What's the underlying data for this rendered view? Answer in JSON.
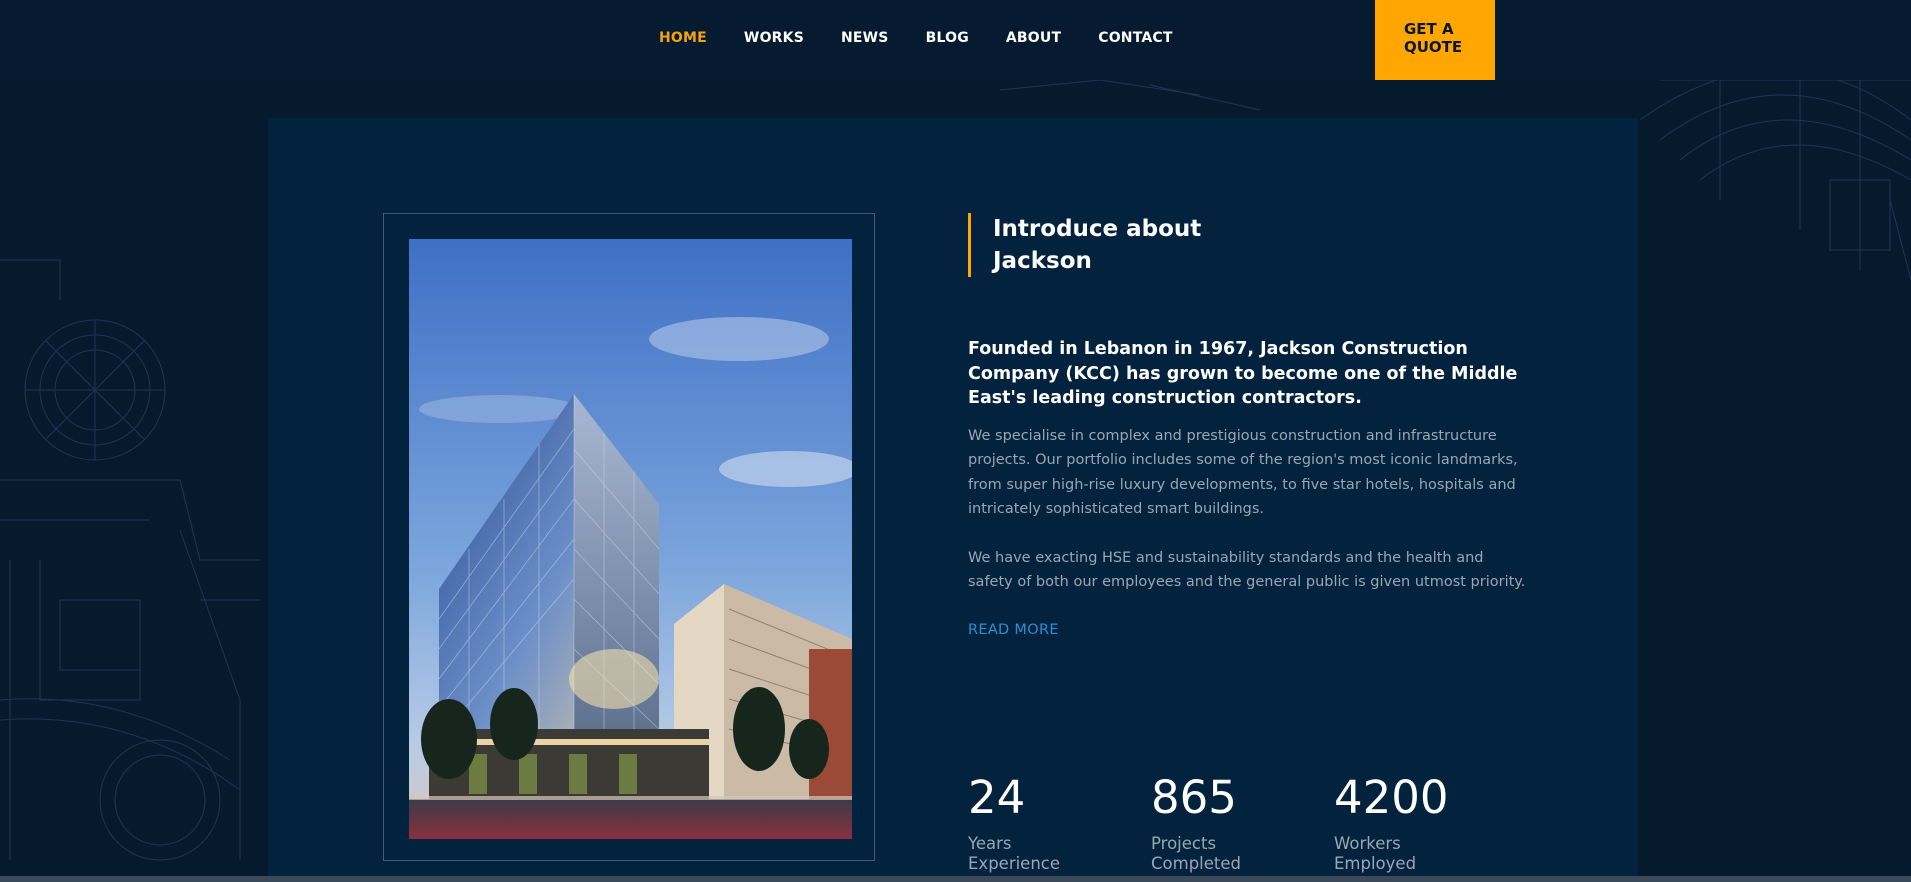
{
  "nav": {
    "items": [
      "HOME",
      "WORKS",
      "NEWS",
      "BLOG",
      "ABOUT",
      "CONTACT"
    ],
    "active_index": 0
  },
  "cta": {
    "line1": "GET A",
    "line2": "QUOTE"
  },
  "about": {
    "title_line1": "Introduce about",
    "title_line2": "Jackson",
    "lead": "Founded in Lebanon in 1967, Jackson Construction Company (KCC) has grown to become one of the Middle East's leading construction contractors.",
    "paragraph1": "We specialise in complex and prestigious construction and infrastructure projects. Our portfolio includes some of the region's most iconic landmarks, from super high-rise luxury developments, to five star hotels, hospitals and intricately sophisticated smart buildings.",
    "paragraph2": "We have exacting HSE and sustainability standards and the health and safety of both our employees and the general public is given utmost priority.",
    "read_more": "READ MORE"
  },
  "stats": [
    {
      "value": "24",
      "label_line1": "Years",
      "label_line2": "Experience"
    },
    {
      "value": "865",
      "label_line1": "Projects",
      "label_line2": "Completed"
    },
    {
      "value": "4200",
      "label_line1": "Workers",
      "label_line2": "Employed"
    }
  ],
  "colors": {
    "accent": "#ffa600",
    "link": "#2b8fd4",
    "panel": "#03223e",
    "background": "#061a2e"
  },
  "image": {
    "subject": "glass-office-building-photo"
  }
}
